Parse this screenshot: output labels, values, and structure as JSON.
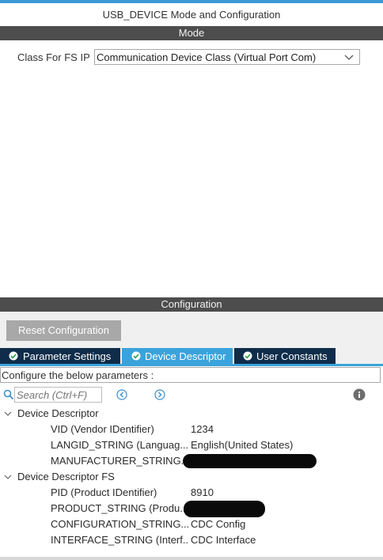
{
  "window": {
    "title": "USB_DEVICE Mode and Configuration"
  },
  "mode": {
    "header": "Mode",
    "class_label": "Class For FS IP",
    "class_value": "Communication Device Class (Virtual Port Com)"
  },
  "configuration": {
    "header": "Configuration",
    "reset_label": "Reset Configuration",
    "tabs": [
      {
        "label": "Parameter Settings",
        "active": false
      },
      {
        "label": "Device Descriptor",
        "active": true
      },
      {
        "label": "User Constants",
        "active": false
      }
    ],
    "configure_text": "Configure the below parameters :",
    "search_placeholder": "Search (Ctrl+F)",
    "groups": [
      {
        "name": "Device Descriptor",
        "params": [
          {
            "name": "VID (Vendor IDentifier)",
            "value": "1234"
          },
          {
            "name": "LANGID_STRING (Languag...",
            "value": "English(United States)"
          },
          {
            "name": "MANUFACTURER_STRING...",
            "value": ""
          }
        ]
      },
      {
        "name": "Device Descriptor FS",
        "params": [
          {
            "name": "PID (Product IDentifier)",
            "value": "8910"
          },
          {
            "name": "PRODUCT_STRING (Produ...",
            "value": ""
          },
          {
            "name": "CONFIGURATION_STRING...",
            "value": "CDC Config"
          },
          {
            "name": "INTERFACE_STRING (Interf...",
            "value": "CDC Interface"
          }
        ]
      }
    ]
  },
  "colors": {
    "accent": "#3aa3db",
    "tab_dark": "#0f2d4b",
    "section_bar": "#4d4d4d",
    "button_gray": "#a8a8a8"
  }
}
